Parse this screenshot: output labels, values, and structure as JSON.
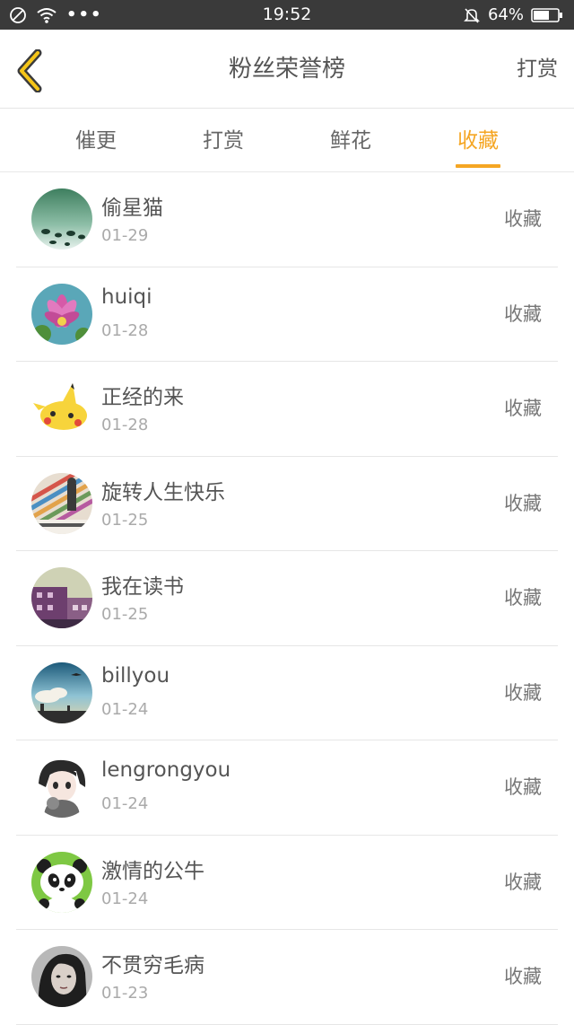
{
  "status_bar": {
    "time": "19:52",
    "battery": "64%",
    "icons": [
      "no-disturb-icon",
      "wifi-icon",
      "more-dots-icon",
      "bell-muted-icon",
      "battery-icon"
    ]
  },
  "header": {
    "title": "粉丝荣誉榜",
    "action_label": "打赏",
    "back_icon": "chevron-left-icon",
    "accent_color": "#f5a623"
  },
  "tabs": [
    {
      "label": "催更",
      "active": false
    },
    {
      "label": "打赏",
      "active": false
    },
    {
      "label": "鲜花",
      "active": false
    },
    {
      "label": "收藏",
      "active": true
    }
  ],
  "fans": [
    {
      "name": "偷星猫",
      "date": "01-29",
      "type": "收藏",
      "avatar": "water-drops-avatar"
    },
    {
      "name": "huiqi",
      "date": "01-28",
      "type": "收藏",
      "avatar": "lotus-avatar"
    },
    {
      "name": "正经的来",
      "date": "01-28",
      "type": "收藏",
      "avatar": "pikachu-avatar"
    },
    {
      "name": "旋转人生快乐",
      "date": "01-25",
      "type": "收藏",
      "avatar": "stripes-photo-avatar"
    },
    {
      "name": "我在读书",
      "date": "01-25",
      "type": "收藏",
      "avatar": "building-avatar"
    },
    {
      "name": "billyou",
      "date": "01-24",
      "type": "收藏",
      "avatar": "sky-avatar"
    },
    {
      "name": "lengrongyou",
      "date": "01-24",
      "type": "收藏",
      "avatar": "anime-girl-avatar"
    },
    {
      "name": "激情的公牛",
      "date": "01-24",
      "type": "收藏",
      "avatar": "panda-avatar"
    },
    {
      "name": "不贯穷毛病",
      "date": "01-23",
      "type": "收藏",
      "avatar": "portrait-avatar"
    }
  ]
}
